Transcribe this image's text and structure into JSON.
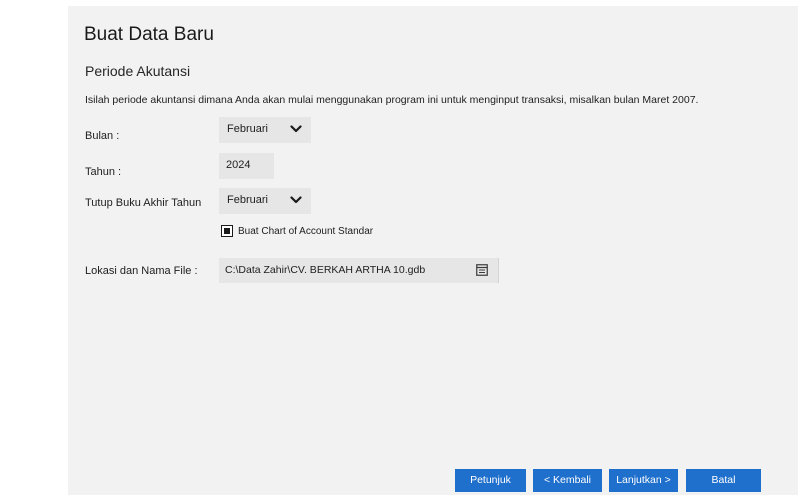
{
  "dialog": {
    "title": "Buat Data Baru",
    "section_title": "Periode Akutansi",
    "description": "Isilah periode akuntansi dimana Anda akan mulai menggunakan program ini untuk menginput transaksi, misalkan bulan Maret 2007."
  },
  "form": {
    "month": {
      "label": "Bulan :",
      "value": "Februari"
    },
    "year": {
      "label": "Tahun :",
      "value": "2024"
    },
    "closing": {
      "label": "Tutup Buku Akhir Tahun",
      "value": "Februari"
    },
    "standard_coa": {
      "label": "Buat Chart of Account Standar",
      "checked": true
    },
    "file": {
      "label": "Lokasi dan Nama File :",
      "value": "C:\\Data Zahir\\CV. BERKAH ARTHA 10.gdb"
    }
  },
  "buttons": {
    "help": "Petunjuk",
    "back": "< Kembali",
    "next": "Lanjutkan >",
    "cancel": "Batal"
  },
  "icons": {
    "dropdown": "chevron-down-icon",
    "browse": "file-browse-icon"
  },
  "colors": {
    "panel_bg": "#f2f2f2",
    "field_bg": "#e6e6e6",
    "button_bg": "#1f6fcc"
  }
}
